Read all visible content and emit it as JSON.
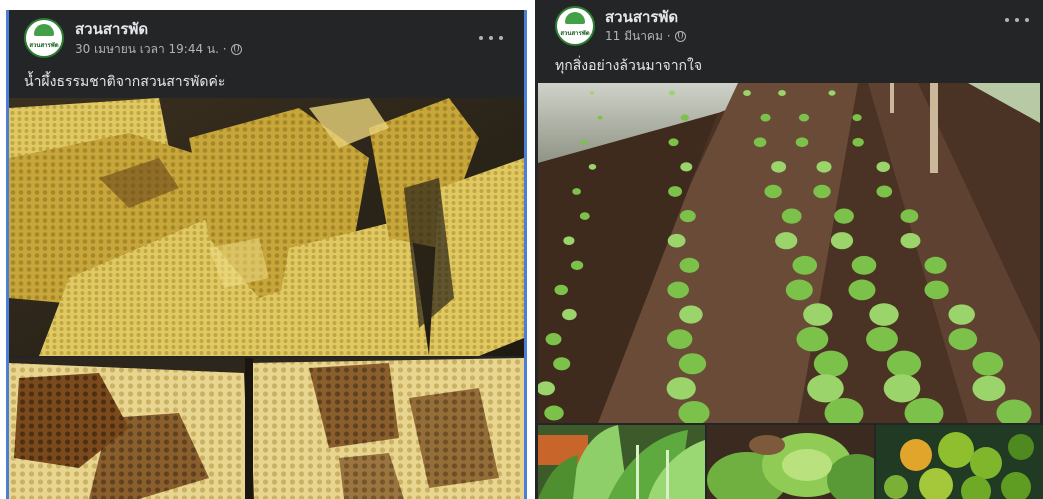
{
  "posts": [
    {
      "page_name": "สวนสารพัด",
      "meta": "30 เมษายน เวลา 19:44 น. ·",
      "caption": "น้ำผึ้งธรรมชาติจากสวนสารพัดค่ะ",
      "avatar_logo_text": "สวนสารพัด",
      "photos": [
        "honeycomb-main-photo",
        "honeycomb-closeup-photo"
      ]
    },
    {
      "page_name": "สวนสารพัด",
      "meta": "11 มีนาคม ·",
      "caption": "ทุกสิ่งอย่างล้วนมาจากใจ",
      "avatar_logo_text": "สวนสารพัด",
      "photos": [
        "vegetable-garden-photo",
        "leafy-greens-photo",
        "lettuce-photo",
        "limes-photo"
      ]
    }
  ],
  "icons": {
    "more": "more-options-icon",
    "audience": "globe-icon"
  },
  "colors": {
    "post_background": "#242526",
    "primary_text": "#e4e6eb",
    "secondary_text": "#b0b3b8",
    "selection_border": "#4b7fd6",
    "honey": "#d8b84a",
    "soil": "#5b3f2e",
    "leaf_green": "#7cc24a"
  }
}
